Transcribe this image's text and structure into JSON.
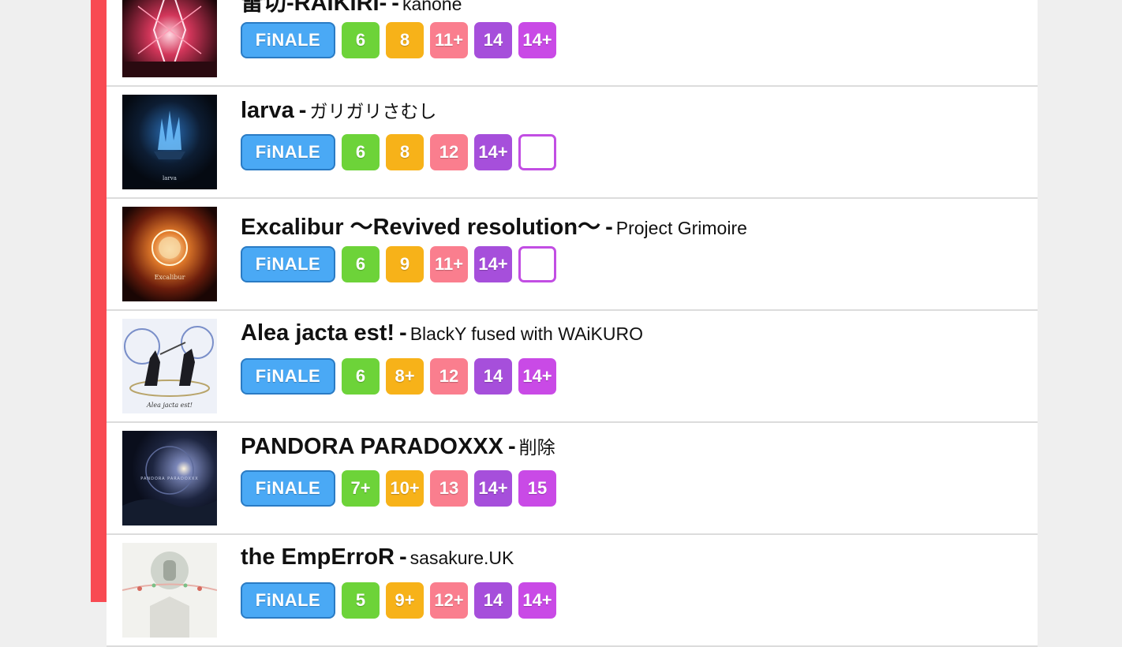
{
  "finale_label": "FiNALE",
  "colors": {
    "accent_bar": "#f84a52",
    "finale": "#4aa9f5",
    "basic": "#6dd339",
    "advanced": "#f7b219",
    "expert": "#fa7e8e",
    "master": "#a64fdb",
    "ultima": "#c94ae6"
  },
  "songs": [
    {
      "title": "雷切-RAIKIRI-",
      "artist": "kanone",
      "jacket_icon": "raikiri-jacket",
      "levels": [
        "6",
        "8",
        "11+",
        "14",
        "14+"
      ]
    },
    {
      "title": "larva",
      "artist": "ガリガリさむし",
      "jacket_icon": "larva-jacket",
      "jacket_caption": "larva",
      "levels": [
        "6",
        "8",
        "12",
        "14+",
        ""
      ]
    },
    {
      "title": "Excalibur ～Revived resolution～",
      "artist": "Project Grimoire",
      "jacket_icon": "excalibur-jacket",
      "jacket_caption": "Excalibur",
      "levels": [
        "6",
        "9",
        "11+",
        "14+",
        ""
      ]
    },
    {
      "title": "Alea jacta est!",
      "artist": "BlackY fused with WAiKURO",
      "jacket_icon": "alea-jacta-est-jacket",
      "jacket_caption": "Alea jacta est!",
      "levels": [
        "6",
        "8+",
        "12",
        "14",
        "14+"
      ]
    },
    {
      "title": "PANDORA PARADOXXX",
      "artist": "削除",
      "jacket_icon": "pandora-paradoxxx-jacket",
      "jacket_caption": "PANDORA PARADOXXX",
      "levels": [
        "7+",
        "10+",
        "13",
        "14+",
        "15"
      ]
    },
    {
      "title": "the EmpErroR",
      "artist": "sasakure.UK",
      "jacket_icon": "the-emperror-jacket",
      "levels": [
        "5",
        "9+",
        "12+",
        "14",
        "14+"
      ]
    }
  ]
}
